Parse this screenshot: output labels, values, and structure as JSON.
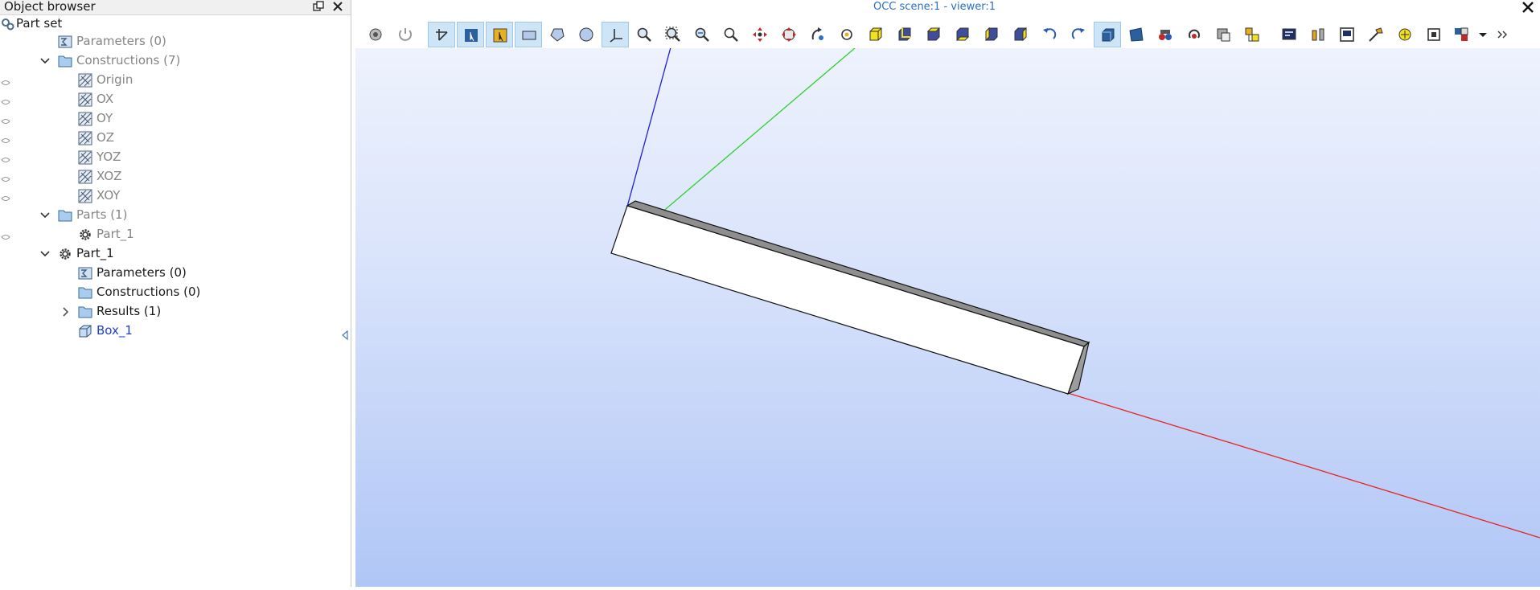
{
  "browser": {
    "title": "Object browser",
    "items": {
      "part_set": "Part set",
      "parameters_top": "Parameters (0)",
      "constructions": "Constructions (7)",
      "origin": "Origin",
      "ox": "OX",
      "oy": "OY",
      "oz": "OZ",
      "yoz": "YOZ",
      "xoz": "XOZ",
      "xoy": "XOY",
      "parts": "Parts (1)",
      "part1_ref": "Part_1",
      "part1": "Part_1",
      "part1_parameters": "Parameters (0)",
      "part1_constructions": "Constructions (0)",
      "part1_results": "Results (1)",
      "box1": "Box_1"
    },
    "colors": {
      "grey_text": "#858585",
      "active_text": "#1c3fd1",
      "folder": "#9fc3e8"
    }
  },
  "viewer": {
    "title": "OCC scene:1 - viewer:1",
    "toolbar_icons": [
      "dump-view-icon",
      "reset-icon",
      "interaction-style-icon",
      "selection-icon",
      "dynamic-selection-icon",
      "rectangle-select-icon",
      "polygon-select-icon",
      "circle-select-icon",
      "trihedron-icon",
      "fit-all-icon",
      "fit-area-icon",
      "fit-selection-icon",
      "zoom-icon",
      "pan-icon",
      "global-pan-icon",
      "rotation-icon",
      "rotation-point-icon",
      "front-view-icon",
      "back-view-icon",
      "top-view-icon",
      "bottom-view-icon",
      "left-view-icon",
      "right-view-icon",
      "rotate-anticlockwise-icon",
      "rotate-clockwise-icon",
      "orthographic-icon",
      "perspective-icon",
      "stereo-icon",
      "synchronize-icon",
      "clipping-icon",
      "graduated-axes-icon",
      "ambient-light-icon",
      "scaling-icon",
      "background-icon",
      "ray-tracing-icon",
      "environment-icon",
      "more-options-icon"
    ],
    "scene_colors": {
      "top": "#eef2fd",
      "bottom": "#b0c6f6",
      "x_axis": "#e8251f",
      "y_axis": "#2ad32a",
      "z_axis": "#2020d8"
    }
  }
}
